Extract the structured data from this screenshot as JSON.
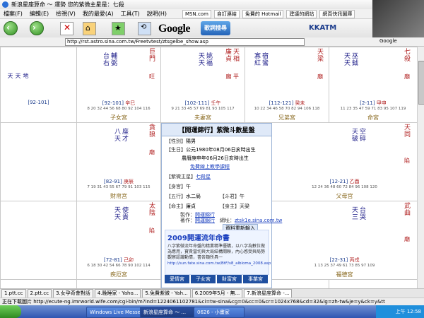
{
  "window": {
    "title": "新浪星座算命 ～ 運勢 您的紫微主星是：七殺"
  },
  "menu": [
    "檔案(F)",
    "編輯(E)",
    "檢視(V)",
    "我的最愛(A)",
    "工具(T)",
    "說明(H)"
  ],
  "links": [
    "MSN.com",
    "自訂連結",
    "免費的 Hotmail",
    "建議的網站",
    "網頁快訊圖庫"
  ],
  "toolbar": {
    "google": "Google",
    "search_button": "歌詞搜尋",
    "kkatm": "KKATM"
  },
  "address": {
    "url": "http://rst.astro.sina.com.tw/Freetvtest/ztsgelbe_show.asp",
    "google_label": "Google"
  },
  "palaces": [
    {
      "name": "子女宮",
      "main": [
        "巨門"
      ],
      "main_status": "旺",
      "minor": [
        "台",
        "輔"
      ],
      "minor2": [
        "右",
        "弼"
      ],
      "range": "92-101",
      "gz": "辛巳",
      "ages": "8 20 32 44 56 68 80 92 104 116"
    },
    {
      "name": "夫妻宮",
      "main": [
        "廉貞",
        "天相"
      ],
      "main_status": "廟 平",
      "minor": [
        "天",
        "姚"
      ],
      "minor2": [
        "天",
        "福"
      ],
      "range": "102-111",
      "gz": "壬午",
      "ages": "9 21 33 45 57 69 81 93 105 117"
    },
    {
      "name": "兄弟宮",
      "main": [
        "天梁"
      ],
      "main_status": "廟",
      "minor": [
        "寡",
        "宿"
      ],
      "minor2": [
        "紅",
        "鸞"
      ],
      "range": "112-121",
      "gz": "癸未",
      "ages": "10 22 34 46 58 70 82 94 106 118"
    },
    {
      "name": "命宮",
      "main": [
        "七殺"
      ],
      "main_status": "廟",
      "minor": [
        "天",
        "巫"
      ],
      "minor2": [
        "天",
        "鉞"
      ],
      "range": "2-11",
      "gz": "甲申",
      "ages": "11 23 35 47 59 71 83 95 107 119"
    },
    {
      "name": "財帛宮",
      "main": [
        "貪狼"
      ],
      "main_status": "廟",
      "minor": [
        "八",
        "座"
      ],
      "minor2": [
        "天",
        "才"
      ],
      "range": "82-91",
      "gz": "庚辰",
      "ages": "7 19 31 43 55 67 79 91 103 115"
    },
    {
      "name": "父母宮",
      "main": [
        "天同"
      ],
      "main_status": "陷",
      "minor": [
        "天",
        "空"
      ],
      "minor2": [
        "破",
        "碎"
      ],
      "range": "12-21",
      "gz": "乙酉",
      "ages": "12 24 36 48 60 72 84 96 108 120"
    },
    {
      "name": "疾厄宮",
      "main": [
        "太陰"
      ],
      "main_status": "陷",
      "minor": [
        "天",
        "使"
      ],
      "minor2": [
        "天",
        "貴"
      ],
      "range": "72-81",
      "gz": "己卯",
      "ages": "6 18 30 42 54 66 78 90 102 114"
    },
    {
      "name": "福德宮",
      "main": [
        "武曲"
      ],
      "main_status": "廟",
      "minor": [
        "天",
        "台"
      ],
      "minor2": [
        "三",
        "哭"
      ],
      "range": "22-31",
      "gz": "丙戌",
      "ages": "1 13 25 37 49 61 73 85 97 109"
    }
  ],
  "center": {
    "heading": "【開運錦行】紫微斗數星盤",
    "gender_label": "【性別】",
    "gender": "陽男",
    "birth_label": "【生日】",
    "birth": "公元1980年08月06日亥時出生",
    "lunar": "農曆庚申年06月26日亥時出生",
    "free_link": "免費線上教學課程",
    "ziwei_label": "【紫微主星】",
    "ziwei": "七殺星",
    "body_label": "【身宮】",
    "body": "午",
    "wuxing_label": "【五行】",
    "wuxing": "水二局",
    "dou_label": "【斗君】",
    "dou": "午",
    "ming_label": "【命主】",
    "ming": "廉貞",
    "shen_label": "【身主】",
    "shen": "天梁",
    "make_label": "製作：",
    "make": "開運錦行",
    "author_label": "著作：",
    "author": "開運錦行",
    "site_label": "網址：",
    "site": "ztsk1e.sina.com.tw",
    "input_btn": "資料重新輸入",
    "promo_title": "2009開運流年命書",
    "promo_desc": "八字紫微流年命盤的精業精準優購，以八字為數位做為應用，寶貴當切與大局結構關聯，內心感受與局勢觀察認識動情，書各類所具一",
    "promo_url": "http://sun.fate.sina.com.tw/BtF/s8_albloma_2008.asp",
    "tabs": [
      "愛情宮",
      "子女宮",
      "財富宮",
      "事業宮"
    ]
  },
  "browser_tabs": [
    "1.ptt.cc",
    "2.ptt.cc",
    "3.女孕奇會對話",
    "4.晚睡家 - Yaho...",
    "5.免費紫微 - Yah...",
    "6.2009年5月 - 無...",
    "7.新浪星座算命 -..."
  ],
  "status_text": "正在下載圖片 http://ecute-ng.imrworld.wife.com/cgi-bin/m?ind=1224061102781&ci=tw-sina&cg=0&cc=0&cr=1024x768&cd=32&lg=zh-tw&je=y&ck=y&tt",
  "taskbar": {
    "tasks": [
      "Windows Live Messen...",
      "新浪星座算命 ～ ...",
      "0626 - 小畫家"
    ],
    "clock": "上午 12:58"
  }
}
